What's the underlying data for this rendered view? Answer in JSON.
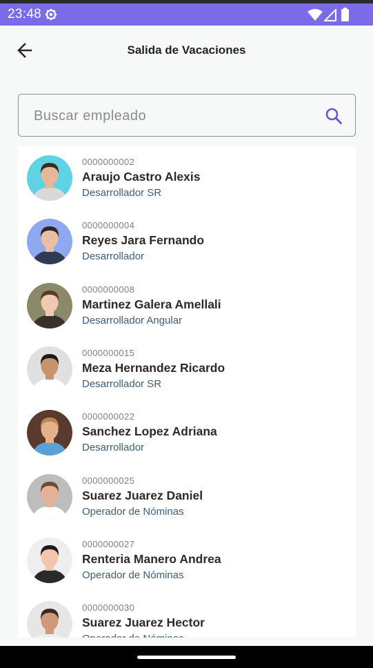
{
  "status_bar": {
    "time": "23:48",
    "icons": [
      "gear-icon",
      "wifi-icon",
      "signal-icon",
      "battery-icon"
    ],
    "background": "#7b6be8"
  },
  "header": {
    "back_icon": "arrow-back-icon",
    "title": "Salida de Vacaciones"
  },
  "search": {
    "placeholder": "Buscar empleado",
    "value": "",
    "icon": "search-icon",
    "accent": "#6a56d8"
  },
  "employees": [
    {
      "id": "0000000002",
      "name": "Araujo Castro Alexis",
      "role": "Desarrollador SR",
      "avatar_bg": "#5fd3e3",
      "skin": "#e7b79a",
      "hair": "#3b2a20",
      "shirt": "#d9d9d9"
    },
    {
      "id": "0000000004",
      "name": "Reyes Jara Fernando",
      "role": "Desarrollador",
      "avatar_bg": "#8fa8f2",
      "skin": "#e8bfa5",
      "hair": "#2d2622",
      "shirt": "#2e3b52"
    },
    {
      "id": "0000000008",
      "name": "Martinez Galera Amellali",
      "role": "Desarrollador Angular",
      "avatar_bg": "#8a8a6a",
      "skin": "#f0c9b3",
      "hair": "#5a3a28",
      "shirt": "#3a2f2a"
    },
    {
      "id": "0000000015",
      "name": "Meza Hernandez Ricardo",
      "role": "Desarrollador SR",
      "avatar_bg": "#e0e0e0",
      "skin": "#c8936f",
      "hair": "#1f1a18",
      "shirt": "#ffffff"
    },
    {
      "id": "0000000022",
      "name": "Sanchez Lopez Adriana",
      "role": "Desarrollador",
      "avatar_bg": "#5a3a2e",
      "skin": "#e4b18f",
      "hair": "#b98a4e",
      "shirt": "#5aa0d8"
    },
    {
      "id": "0000000025",
      "name": "Suarez Juarez Daniel",
      "role": "Operador de Nóminas",
      "avatar_bg": "#bdbdbd",
      "skin": "#e3b295",
      "hair": "#6b4b35",
      "shirt": "#ffffff"
    },
    {
      "id": "0000000027",
      "name": "Renteria Manero Andrea",
      "role": "Operador de Nóminas",
      "avatar_bg": "#eeeeee",
      "skin": "#f1c6ad",
      "hair": "#1c1a1a",
      "shirt": "#2a2a2a"
    },
    {
      "id": "0000000030",
      "name": "Suarez Juarez Hector",
      "role": "Operador de Nóminas",
      "avatar_bg": "#e6e6e6",
      "skin": "#cf9a7a",
      "hair": "#3a2a22",
      "shirt": "#efefef"
    }
  ],
  "nav_bar": {
    "handle": "home-gesture-handle"
  }
}
